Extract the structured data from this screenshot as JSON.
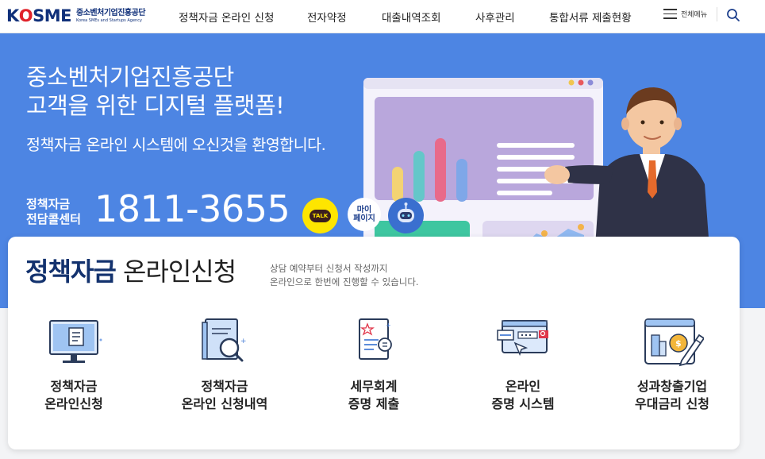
{
  "header": {
    "logo_word": "KOSME",
    "logo_ko": "중소벤처기업진흥공단",
    "logo_en": "Korea SMEs and Startups Agency",
    "nav": [
      "정책자금 온라인 신청",
      "전자약정",
      "대출내역조회",
      "사후관리",
      "통합서류 제출현황"
    ],
    "all_menu": "전체메뉴"
  },
  "hero": {
    "title_line1": "중소벤처기업진흥공단",
    "title_line2": "고객을 위한 디지털 플랫폼!",
    "subtitle": "정책자금 온라인 시스템에 오신것을 환영합니다.",
    "call_label_line1": "정책자금",
    "call_label_line2": "전담콜센터",
    "phone": "1811-3655",
    "talk_label": "TALK",
    "mypage_line1": "마이",
    "mypage_line2": "페이지"
  },
  "card": {
    "title_strong": "정책자금",
    "title_light": "온라인신청",
    "desc_line1": "상담 예약부터 신청서 작성까지",
    "desc_line2": "온라인으로 한번에 진행할 수 있습니다.",
    "services": [
      {
        "line1": "정책자금",
        "line2": "온라인신청",
        "icon": "monitor-document-icon"
      },
      {
        "line1": "정책자금",
        "line2": "온라인 신청내역",
        "icon": "document-magnifier-icon"
      },
      {
        "line1": "세무회계",
        "line2": "증명 제출",
        "icon": "tax-document-icon"
      },
      {
        "line1": "온라인",
        "line2": "증명 시스템",
        "icon": "online-browser-icon"
      },
      {
        "line1": "성과창출기업",
        "line2": "우대금리 신청",
        "icon": "coin-pencil-icon"
      }
    ]
  },
  "colors": {
    "hero_bg": "#4d85e3",
    "brand_navy": "#13326e",
    "logo_red": "#e0232b",
    "kakao_yellow": "#fee500"
  }
}
